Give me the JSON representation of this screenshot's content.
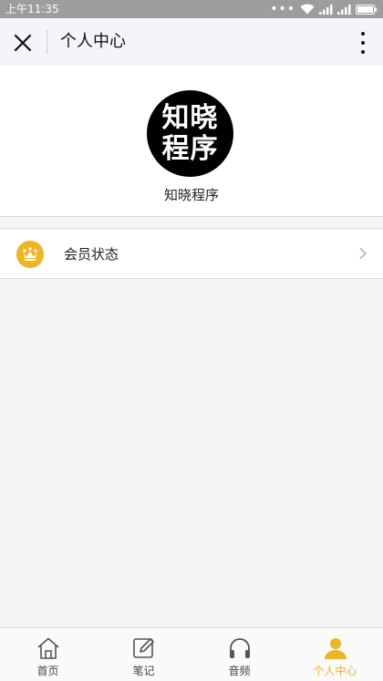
{
  "status_bar": {
    "time": "上午11:35",
    "dots": "•••"
  },
  "nav": {
    "title": "个人中心"
  },
  "profile": {
    "avatar_line1": "知晓",
    "avatar_line2": "程序",
    "name": "知晓程序"
  },
  "menu": {
    "items": [
      {
        "label": "会员状态",
        "icon": "crown-icon"
      }
    ]
  },
  "tabs": [
    {
      "label": "首页",
      "icon": "home-icon",
      "active": false
    },
    {
      "label": "笔记",
      "icon": "edit-icon",
      "active": false
    },
    {
      "label": "音频",
      "icon": "headphones-icon",
      "active": false
    },
    {
      "label": "个人中心",
      "icon": "user-icon",
      "active": true
    }
  ],
  "colors": {
    "accent": "#f0b425",
    "status_bar": "#9d9d9d",
    "nav_bg": "#f6f4fa",
    "page_bg": "#f5f5f5"
  }
}
